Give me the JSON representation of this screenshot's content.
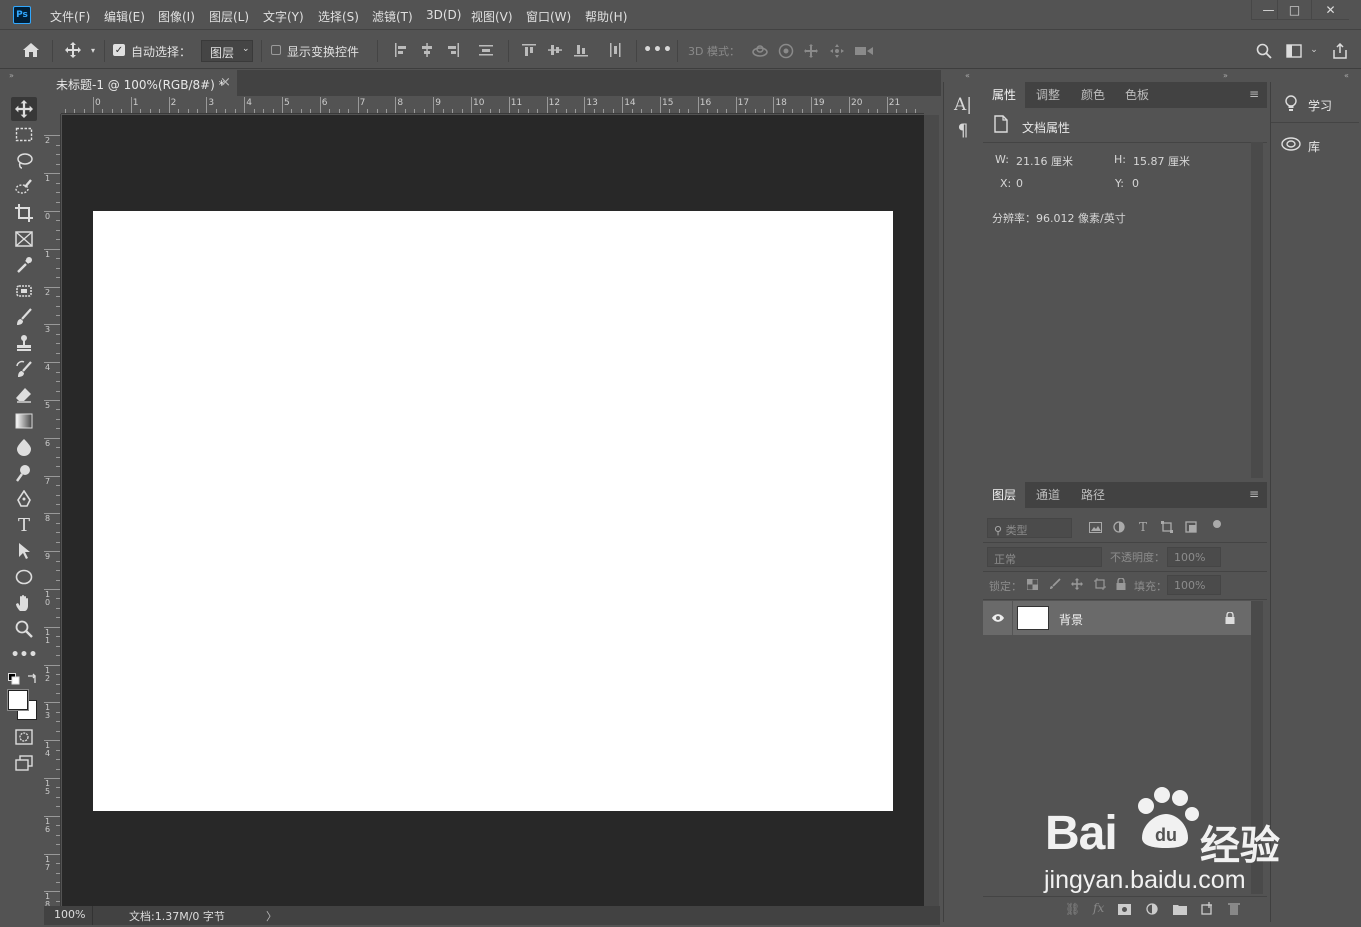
{
  "app": {
    "logo": "Ps"
  },
  "menu": [
    {
      "label": "文件(F)"
    },
    {
      "label": "编辑(E)"
    },
    {
      "label": "图像(I)"
    },
    {
      "label": "图层(L)"
    },
    {
      "label": "文字(Y)"
    },
    {
      "label": "选择(S)"
    },
    {
      "label": "滤镜(T)"
    },
    {
      "label": "3D(D)"
    },
    {
      "label": "视图(V)"
    },
    {
      "label": "窗口(W)"
    },
    {
      "label": "帮助(H)"
    }
  ],
  "window_controls": {
    "minimize": "—",
    "restore": "□",
    "close": "✕"
  },
  "options": {
    "auto_select_label": "自动选择：",
    "auto_select_checked": true,
    "auto_select_target": "图层",
    "show_transform_label": "显示变换控件",
    "mode_3d_label": "3D 模式："
  },
  "document": {
    "tab_title": "未标题-1 @ 100%(RGB/8#) *",
    "close": "×",
    "canvas_color": "#ffffff",
    "ruler_h": [
      "0",
      "1",
      "2",
      "3",
      "4",
      "5",
      "6",
      "7",
      "8",
      "9",
      "10",
      "11",
      "12",
      "13",
      "14",
      "15",
      "16",
      "17",
      "18",
      "19",
      "20",
      "21"
    ],
    "ruler_v": [
      "2",
      "1",
      "0",
      "1",
      "2",
      "3",
      "4",
      "5",
      "6",
      "7",
      "8",
      "9",
      "10",
      "11",
      "12",
      "13",
      "14",
      "15",
      "16",
      "17",
      "18"
    ]
  },
  "status": {
    "zoom": "100%",
    "doc_info": "文档:1.37M/0 字节",
    "arrow": "〉"
  },
  "properties": {
    "tabs": [
      "属性",
      "调整",
      "颜色",
      "色板"
    ],
    "section_title": "文档属性",
    "w_label": "W:",
    "w_value": "21.16 厘米",
    "h_label": "H:",
    "h_value": "15.87 厘米",
    "x_label": "X:",
    "x_value": "0",
    "y_label": "Y:",
    "y_value": "0",
    "resolution": "分辨率：96.012 像素/英寸"
  },
  "layers": {
    "tabs": [
      "图层",
      "通道",
      "路径"
    ],
    "filter_placeholder": "类型",
    "blend_mode": "正常",
    "opacity_label": "不透明度：",
    "opacity_value": "100%",
    "lock_label": "锁定：",
    "fill_label": "填充：",
    "fill_value": "100%",
    "items": [
      {
        "name": "背景",
        "visible": true,
        "locked": true
      }
    ]
  },
  "learn": {
    "learn_label": "学习",
    "library_label": "库"
  },
  "watermark": {
    "brand": "Bai",
    "brand2": "经验",
    "url": "jingyan.baidu.com"
  }
}
